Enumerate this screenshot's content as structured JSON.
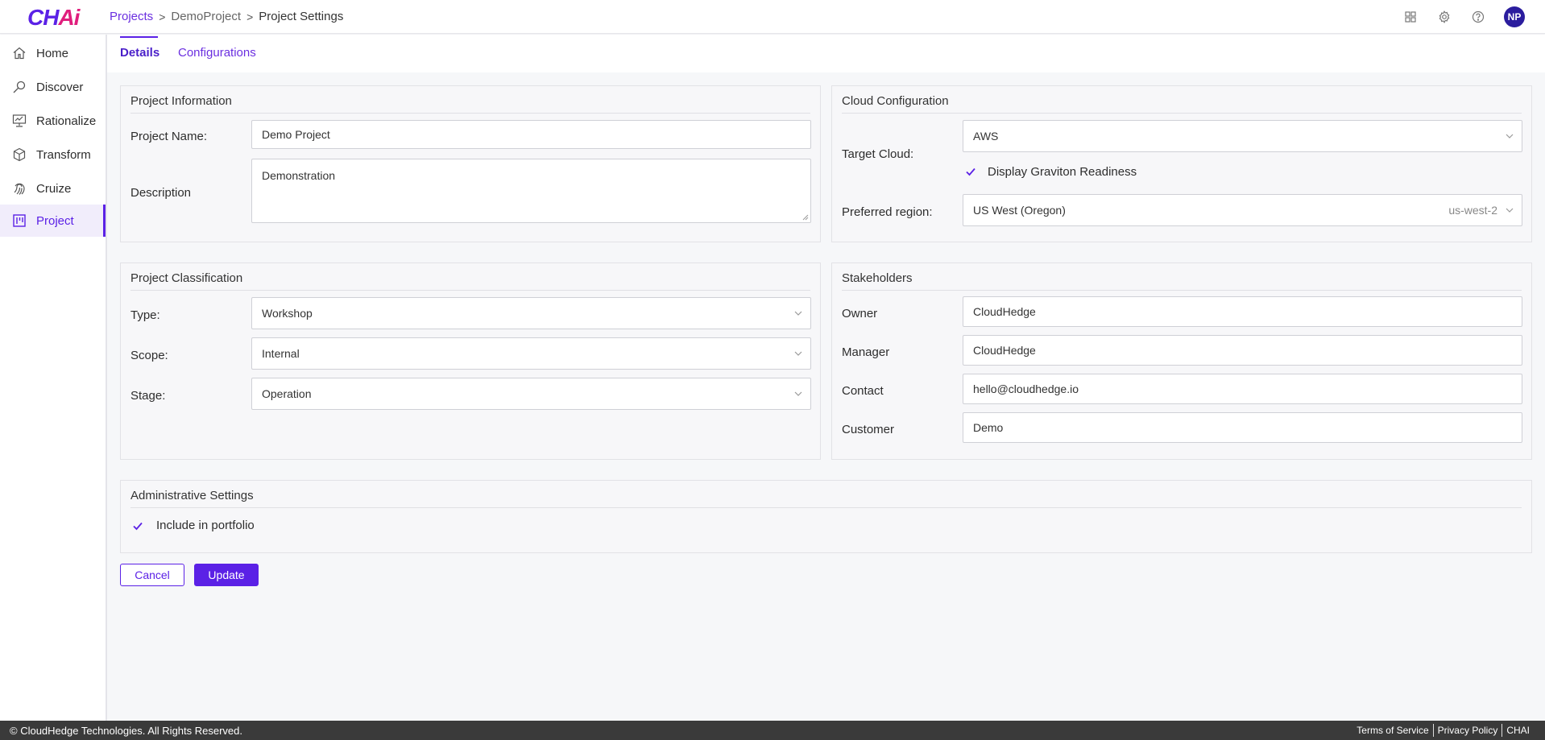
{
  "app": {
    "logo_main": "CH",
    "logo_accent": "Ai"
  },
  "breadcrumb": {
    "projects": "Projects",
    "project": "DemoProject",
    "current": "Project Settings",
    "sep": ">"
  },
  "header": {
    "avatar_initials": "NP",
    "icons": [
      "apps-grid-icon",
      "gear-icon",
      "help-icon"
    ]
  },
  "sidebar": {
    "items": [
      {
        "label": "Home",
        "icon": "home-icon"
      },
      {
        "label": "Discover",
        "icon": "discover-icon"
      },
      {
        "label": "Rationalize",
        "icon": "rationalize-icon"
      },
      {
        "label": "Transform",
        "icon": "cube-icon"
      },
      {
        "label": "Cruize",
        "icon": "fingerprint-icon"
      },
      {
        "label": "Project",
        "icon": "kanban-icon",
        "active": true
      }
    ]
  },
  "tabs": [
    {
      "label": "Details",
      "active": true
    },
    {
      "label": "Configurations",
      "active": false
    }
  ],
  "project_info": {
    "title": "Project Information",
    "name_label": "Project Name:",
    "name_value": "Demo Project",
    "desc_label": "Description",
    "desc_value": "Demonstration"
  },
  "cloud_config": {
    "title": "Cloud Configuration",
    "target_label": "Target Cloud:",
    "target_value": "AWS",
    "graviton_label": "Display Graviton Readiness",
    "graviton_checked": true,
    "region_label": "Preferred region:",
    "region_value": "US West (Oregon)",
    "region_code": "us-west-2"
  },
  "classification": {
    "title": "Project Classification",
    "type_label": "Type:",
    "type_value": "Workshop",
    "scope_label": "Scope:",
    "scope_value": "Internal",
    "stage_label": "Stage:",
    "stage_value": "Operation"
  },
  "stakeholders": {
    "title": "Stakeholders",
    "owner_label": "Owner",
    "owner_value": "CloudHedge",
    "manager_label": "Manager",
    "manager_value": "CloudHedge",
    "contact_label": "Contact",
    "contact_value": "hello@cloudhedge.io",
    "customer_label": "Customer",
    "customer_value": "Demo"
  },
  "admin": {
    "title": "Administrative Settings",
    "portfolio_label": "Include in portfolio",
    "portfolio_checked": true
  },
  "actions": {
    "cancel": "Cancel",
    "update": "Update"
  },
  "footer": {
    "copyright": "© CloudHedge Technologies. All Rights Reserved.",
    "terms": "Terms of Service",
    "privacy": "Privacy Policy",
    "brand": "CHAI"
  },
  "colors": {
    "accent": "#5b21e6",
    "logo_accent": "#e01e7d",
    "footer_bg": "#3a3a3a"
  }
}
